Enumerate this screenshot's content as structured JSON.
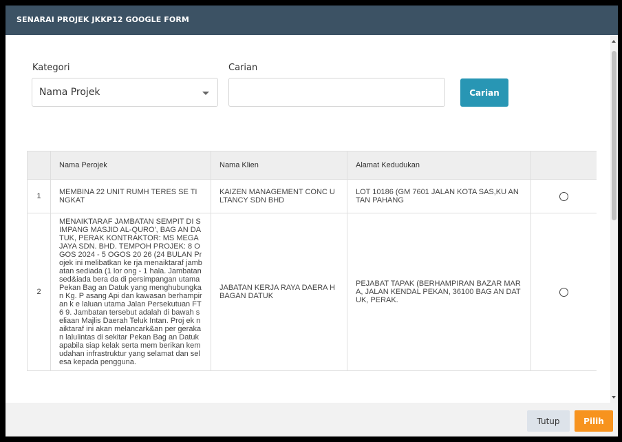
{
  "modal": {
    "title": "SENARAI PROJEK JKKP12 GOOGLE FORM"
  },
  "filter": {
    "kategori_label": "Kategori",
    "kategori_value": "Nama Projek",
    "carian_label": "Carian",
    "carian_value": "",
    "search_button": "Carian"
  },
  "table": {
    "headers": [
      "",
      "Nama Perojek",
      "Nama Klien",
      "Alamat Kedudukan",
      ""
    ],
    "rows": [
      {
        "no": "1",
        "nama_projek": "MEMBINA 22 UNIT RUMH TERES SE TINGKAT",
        "nama_klien": "KAIZEN MANAGEMENT CONC ULTANCY SDN BHD",
        "alamat": "LOT 10186 (GM 7601 JALAN KOTA SAS,KU ANTAN PAHANG"
      },
      {
        "no": "2",
        "nama_projek": "MENAIKTARAF JAMBATAN SEMPIT DI SIMPANG MASJID AL-QURO', BAG AN DATUK, PERAK KONTRAKTOR: MS MEGA JAYA SDN. BHD. TEMPOH PROJEK: 8 OGOS 2024 - 5 OGOS 20 26 (24 BULAN Projek ini melibatkan ke rja menaiktaraf jambatan sediada (1 lor ong - 1 hala. Jambatan sed&iada bera da di persimpangan utama Pekan Bag an Datuk yang menghubungkan Kg. P asang Api dan kawasan berhampiran k e laluan utama Jalan Persekutuan FT6 9. Jambatan tersebut adalah di bawah seliaan Majlis Daerah Teluk Intan. Proj ek naiktaraf ini akan melancark&an per gerakan lalulintas di sekitar Pekan Bag an Datuk apabila siap kelak serta mem berikan kemudahan infrastruktur yang selamat dan selesa kepada pengguna.",
        "nama_klien": "JABATAN KERJA RAYA DAERA H BAGAN DATUK",
        "alamat": "PEJABAT TAPAK (BERHAMPIRAN BAZAR MARA, JALAN KENDAL PEKAN, 36100 BAG AN DATUK, PERAK."
      }
    ]
  },
  "footer": {
    "tutup": "Tutup",
    "pilih": "Pilih"
  },
  "colors": {
    "header_bg": "#3c5264",
    "search_button": "#2896b4",
    "pilih_button": "#f7931e",
    "tutup_button": "#dde3ea"
  }
}
